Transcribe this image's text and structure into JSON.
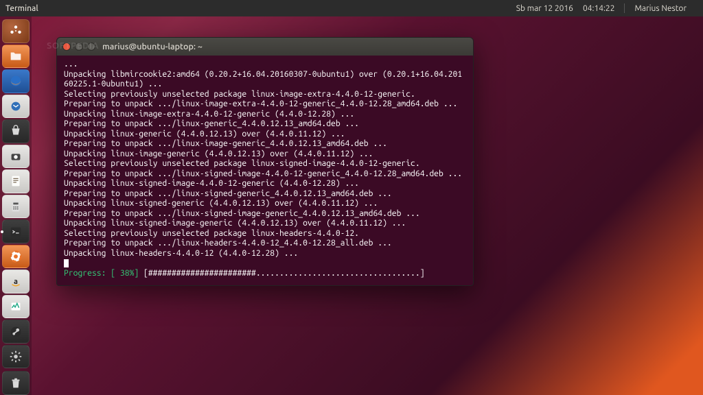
{
  "panel": {
    "app_title": "Terminal",
    "date": "Sb mar 12 2016",
    "time": "04:14:22",
    "user": "Marius Nestor"
  },
  "watermark": "SOFTPEDIA",
  "launcher": {
    "items": [
      {
        "name": "dash",
        "label": "Dash"
      },
      {
        "name": "files",
        "label": "Files"
      },
      {
        "name": "firefox",
        "label": "Firefox"
      },
      {
        "name": "thunderbird",
        "label": "Thunderbird"
      },
      {
        "name": "software",
        "label": "Software Center"
      },
      {
        "name": "screenshot",
        "label": "Screenshot"
      },
      {
        "name": "text-editor",
        "label": "Text Editor"
      },
      {
        "name": "calculator",
        "label": "Calculator"
      },
      {
        "name": "terminal",
        "label": "Terminal"
      },
      {
        "name": "help",
        "label": "Help"
      },
      {
        "name": "amazon",
        "label": "Amazon"
      },
      {
        "name": "monitor",
        "label": "System Monitor"
      },
      {
        "name": "steam",
        "label": "Steam"
      },
      {
        "name": "settings",
        "label": "System Settings"
      },
      {
        "name": "trash",
        "label": "Trash"
      }
    ]
  },
  "terminal": {
    "title": "marius@ubuntu-laptop: ~",
    "lines": [
      "...",
      "Unpacking libmircookie2:amd64 (0.20.2+16.04.20160307-0ubuntu1) over (0.20.1+16.04.20160225.1-0ubuntu1) ...",
      "Selecting previously unselected package linux-image-extra-4.4.0-12-generic.",
      "Preparing to unpack .../linux-image-extra-4.4.0-12-generic_4.4.0-12.28_amd64.deb ...",
      "Unpacking linux-image-extra-4.4.0-12-generic (4.4.0-12.28) ...",
      "Preparing to unpack .../linux-generic_4.4.0.12.13_amd64.deb ...",
      "Unpacking linux-generic (4.4.0.12.13) over (4.4.0.11.12) ...",
      "Preparing to unpack .../linux-image-generic_4.4.0.12.13_amd64.deb ...",
      "Unpacking linux-image-generic (4.4.0.12.13) over (4.4.0.11.12) ...",
      "Selecting previously unselected package linux-signed-image-4.4.0-12-generic.",
      "Preparing to unpack .../linux-signed-image-4.4.0-12-generic_4.4.0-12.28_amd64.deb ...",
      "Unpacking linux-signed-image-4.4.0-12-generic (4.4.0-12.28) ...",
      "Preparing to unpack .../linux-signed-generic_4.4.0.12.13_amd64.deb ...",
      "Unpacking linux-signed-generic (4.4.0.12.13) over (4.4.0.11.12) ...",
      "Preparing to unpack .../linux-signed-image-generic_4.4.0.12.13_amd64.deb ...",
      "Unpacking linux-signed-image-generic (4.4.0.12.13) over (4.4.0.11.12) ...",
      "Selecting previously unselected package linux-headers-4.4.0-12.",
      "Preparing to unpack .../linux-headers-4.4.0-12_4.4.0-12.28_all.deb ...",
      "Unpacking linux-headers-4.4.0-12 (4.4.0-12.28) ..."
    ],
    "progress_label": "Progress: [ 38%]",
    "progress_bar": "[#######################...................................]"
  }
}
